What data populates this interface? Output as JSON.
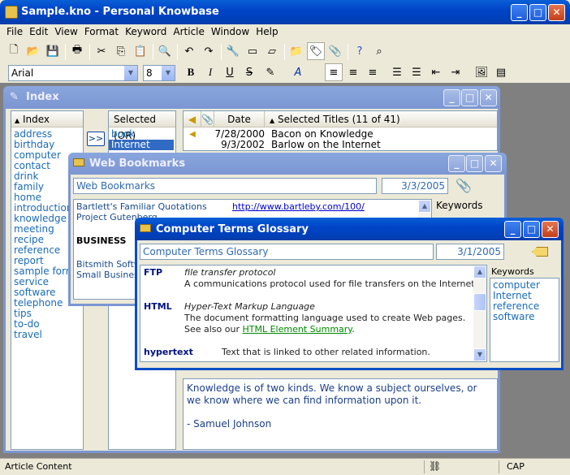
{
  "app": {
    "title": "Sample.kno - Personal Knowbase"
  },
  "menu": [
    "File",
    "Edit",
    "View",
    "Format",
    "Keyword",
    "Article",
    "Window",
    "Help"
  ],
  "format": {
    "font": "Arial",
    "size": "8"
  },
  "index_window": {
    "title": "Index",
    "index_header": "Index",
    "selected_header": "Selected (OR)",
    "move_button": ">>",
    "keywords": [
      "address",
      "birthday",
      "computer",
      "contact",
      "drink",
      "family",
      "home",
      "introduction",
      "knowledge",
      "meeting",
      "recipe",
      "reference",
      "report",
      "sample form",
      "service",
      "software",
      "telephone",
      "tips",
      "to-do",
      "travel"
    ],
    "selected": [
      "book",
      "Internet"
    ],
    "col_date": "Date",
    "col_titles": "Selected Titles (11 of 41)",
    "titles": [
      {
        "date": "7/28/2000",
        "title": "Bacon on Knowledge"
      },
      {
        "date": "9/3/2002",
        "title": "Barlow on the Internet"
      }
    ],
    "article_text": "Knowledge is of two kinds.  We know a subject ourselves, or we know where we can find information upon it.",
    "article_author": "- Samuel Johnson"
  },
  "web_window": {
    "title": "Web Bookmarks",
    "field_title": "Web Bookmarks",
    "field_date": "3/3/2005",
    "keywords_label": "Keywords",
    "rows": [
      {
        "left": "Bartlett's Familiar Quotations",
        "right": "http://www.bartleby.com/100/"
      },
      {
        "left": "Project Gutenberg",
        "right": ""
      }
    ],
    "section": "BUSINESS",
    "rows2": [
      "Bitsmith Software",
      "Small Business"
    ]
  },
  "glossary_window": {
    "title": "Computer Terms Glossary",
    "field_title": "Computer Terms Glossary",
    "field_date": "3/1/2005",
    "keywords_label": "Keywords",
    "keywords": [
      "computer",
      "Internet",
      "reference",
      "software"
    ],
    "entries": [
      {
        "term": "FTP",
        "def_italic": "file transfer protocol",
        "def": "A communications protocol used for file transfers on the Internet."
      },
      {
        "term": "HTML",
        "def_italic": "Hyper-Text Markup Language",
        "def": "The document formatting language used to create Web pages.",
        "see_prefix": "See also our ",
        "see_link": "HTML Element Summary",
        "see_suffix": "."
      },
      {
        "term": "hypertext",
        "def": "Text that is linked to other related information."
      }
    ]
  },
  "status": {
    "left": "Article Content",
    "right": "CAP"
  }
}
